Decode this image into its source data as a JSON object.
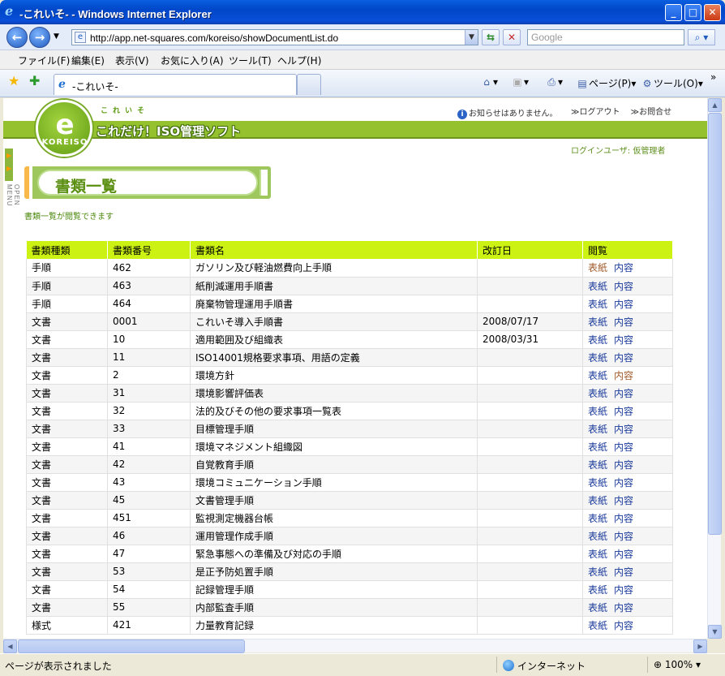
{
  "window": {
    "title": "-これいそ- - Windows Internet Explorer"
  },
  "address": {
    "url": "http://app.net-squares.com/koreiso/showDocumentList.do",
    "search_placeholder": "Google"
  },
  "menu": [
    "ファイル(F)",
    "編集(E)",
    "表示(V)",
    "お気に入り(A)",
    "ツール(T)",
    "ヘルプ(H)"
  ],
  "tab": {
    "label": "-これいそ-"
  },
  "commands": {
    "page": "ページ(P)",
    "tools": "ツール(O)"
  },
  "page": {
    "logo_sub": "これいそ",
    "logo_title": "これだけ！ISO管理ソフト",
    "logo_ring": "KOREISO",
    "notice": "お知らせはありません。",
    "logout": "≫ログアウト",
    "contact": "≫お問合せ",
    "login_user": "ログインユーザ: 仮管理者",
    "side_menu": "OPEN MENU",
    "heading": "書類一覧",
    "subtitle": "書類一覧が閲覧できます",
    "columns": [
      "書類種類",
      "書類番号",
      "書類名",
      "改訂日",
      "閲覧"
    ],
    "link_labels": {
      "paper": "表紙",
      "content": "内容"
    },
    "rows": [
      {
        "type": "手順",
        "num": "462",
        "name": "ガソリン及び軽油燃費向上手順",
        "date": "",
        "paper_visited": true,
        "content_visited": false
      },
      {
        "type": "手順",
        "num": "463",
        "name": "紙削減運用手順書",
        "date": "",
        "paper_visited": false,
        "content_visited": false
      },
      {
        "type": "手順",
        "num": "464",
        "name": "廃棄物管理運用手順書",
        "date": "",
        "paper_visited": false,
        "content_visited": false
      },
      {
        "type": "文書",
        "num": "0001",
        "name": "これいそ導入手順書",
        "date": "2008/07/17",
        "paper_visited": false,
        "content_visited": false
      },
      {
        "type": "文書",
        "num": "10",
        "name": "適用範囲及び組織表",
        "date": "2008/03/31",
        "paper_visited": false,
        "content_visited": false
      },
      {
        "type": "文書",
        "num": "11",
        "name": "ISO14001規格要求事項、用語の定義",
        "date": "",
        "paper_visited": false,
        "content_visited": false
      },
      {
        "type": "文書",
        "num": "2",
        "name": "環境方針",
        "date": "",
        "paper_visited": false,
        "content_visited": true
      },
      {
        "type": "文書",
        "num": "31",
        "name": "環境影響評価表",
        "date": "",
        "paper_visited": false,
        "content_visited": false
      },
      {
        "type": "文書",
        "num": "32",
        "name": "法的及びその他の要求事項一覧表",
        "date": "",
        "paper_visited": false,
        "content_visited": false
      },
      {
        "type": "文書",
        "num": "33",
        "name": "目標管理手順",
        "date": "",
        "paper_visited": false,
        "content_visited": false
      },
      {
        "type": "文書",
        "num": "41",
        "name": "環境マネジメント組織図",
        "date": "",
        "paper_visited": false,
        "content_visited": false
      },
      {
        "type": "文書",
        "num": "42",
        "name": "自覚教育手順",
        "date": "",
        "paper_visited": false,
        "content_visited": false
      },
      {
        "type": "文書",
        "num": "43",
        "name": "環境コミュニケーション手順",
        "date": "",
        "paper_visited": false,
        "content_visited": false
      },
      {
        "type": "文書",
        "num": "45",
        "name": "文書管理手順",
        "date": "",
        "paper_visited": false,
        "content_visited": false
      },
      {
        "type": "文書",
        "num": "451",
        "name": "監視測定機器台帳",
        "date": "",
        "paper_visited": false,
        "content_visited": false
      },
      {
        "type": "文書",
        "num": "46",
        "name": "運用管理作成手順",
        "date": "",
        "paper_visited": false,
        "content_visited": false
      },
      {
        "type": "文書",
        "num": "47",
        "name": "緊急事態への準備及び対応の手順",
        "date": "",
        "paper_visited": false,
        "content_visited": false
      },
      {
        "type": "文書",
        "num": "53",
        "name": "是正予防処置手順",
        "date": "",
        "paper_visited": false,
        "content_visited": false
      },
      {
        "type": "文書",
        "num": "54",
        "name": "記録管理手順",
        "date": "",
        "paper_visited": false,
        "content_visited": false
      },
      {
        "type": "文書",
        "num": "55",
        "name": "内部監査手順",
        "date": "",
        "paper_visited": false,
        "content_visited": false
      },
      {
        "type": "様式",
        "num": "421",
        "name": "力量教育記録",
        "date": "",
        "paper_visited": false,
        "content_visited": false
      }
    ]
  },
  "status": {
    "message": "ページが表示されました",
    "zone": "インターネット",
    "zoom": "100%"
  }
}
